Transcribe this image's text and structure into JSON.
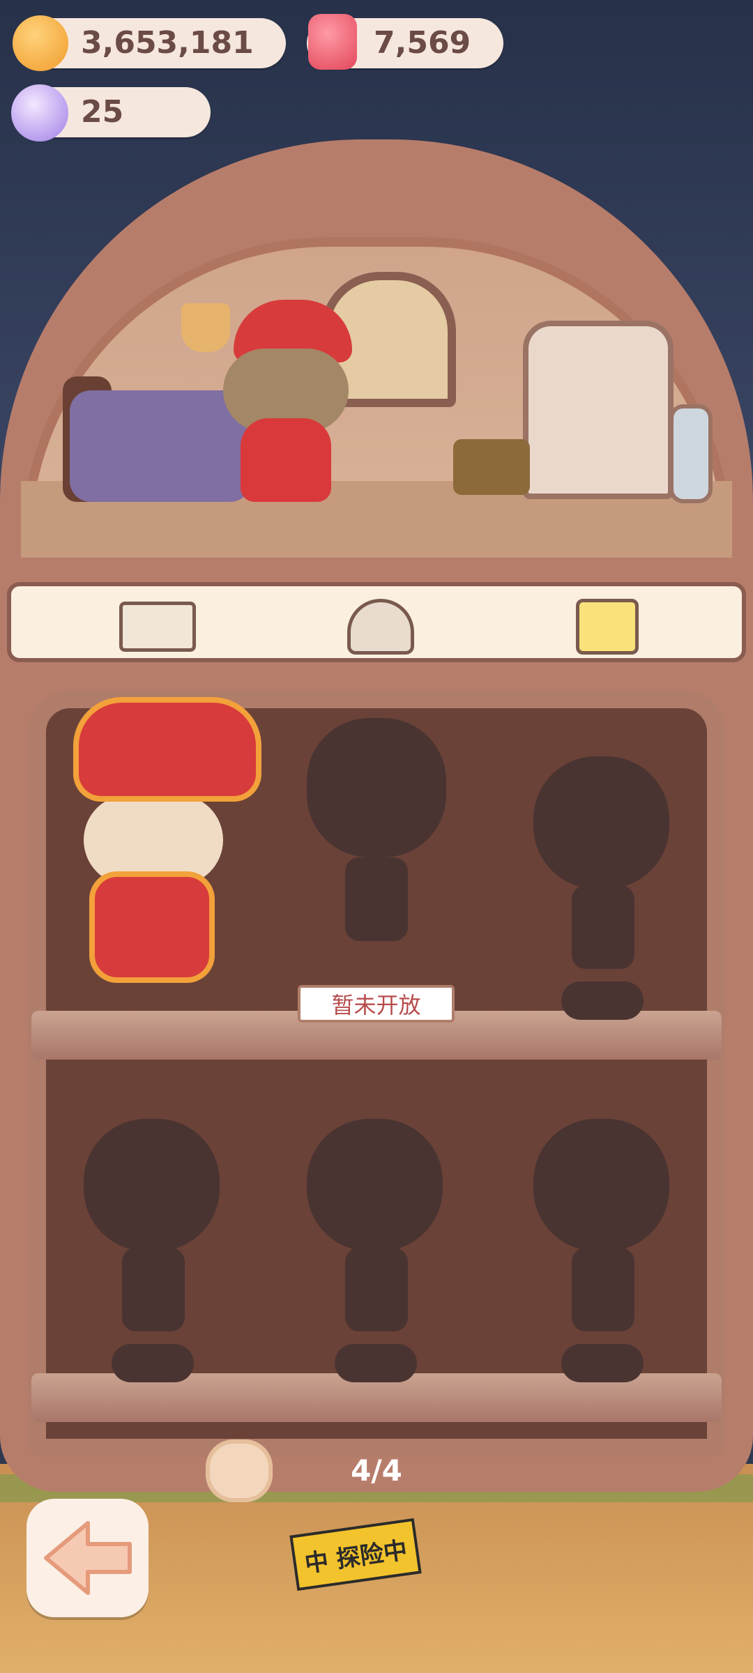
{
  "top_bar": {
    "coins": "3,653,181",
    "gems": "7,569",
    "candies": "25"
  },
  "tabs": [
    {
      "icon": "book-icon"
    },
    {
      "icon": "hotel-icon"
    },
    {
      "icon": "shirt-icon"
    }
  ],
  "wardrobe": {
    "locked_label": "暂未开放"
  },
  "pager": {
    "page": "4/4"
  },
  "bottom": {
    "tape_text": "中 探险中"
  },
  "colors": {
    "panel": "#fbefdf",
    "cabinet": "#6a4238",
    "frame": "#b77d6b",
    "outfit_red": "#d83b3b",
    "outline_orange": "#f3a13a"
  }
}
